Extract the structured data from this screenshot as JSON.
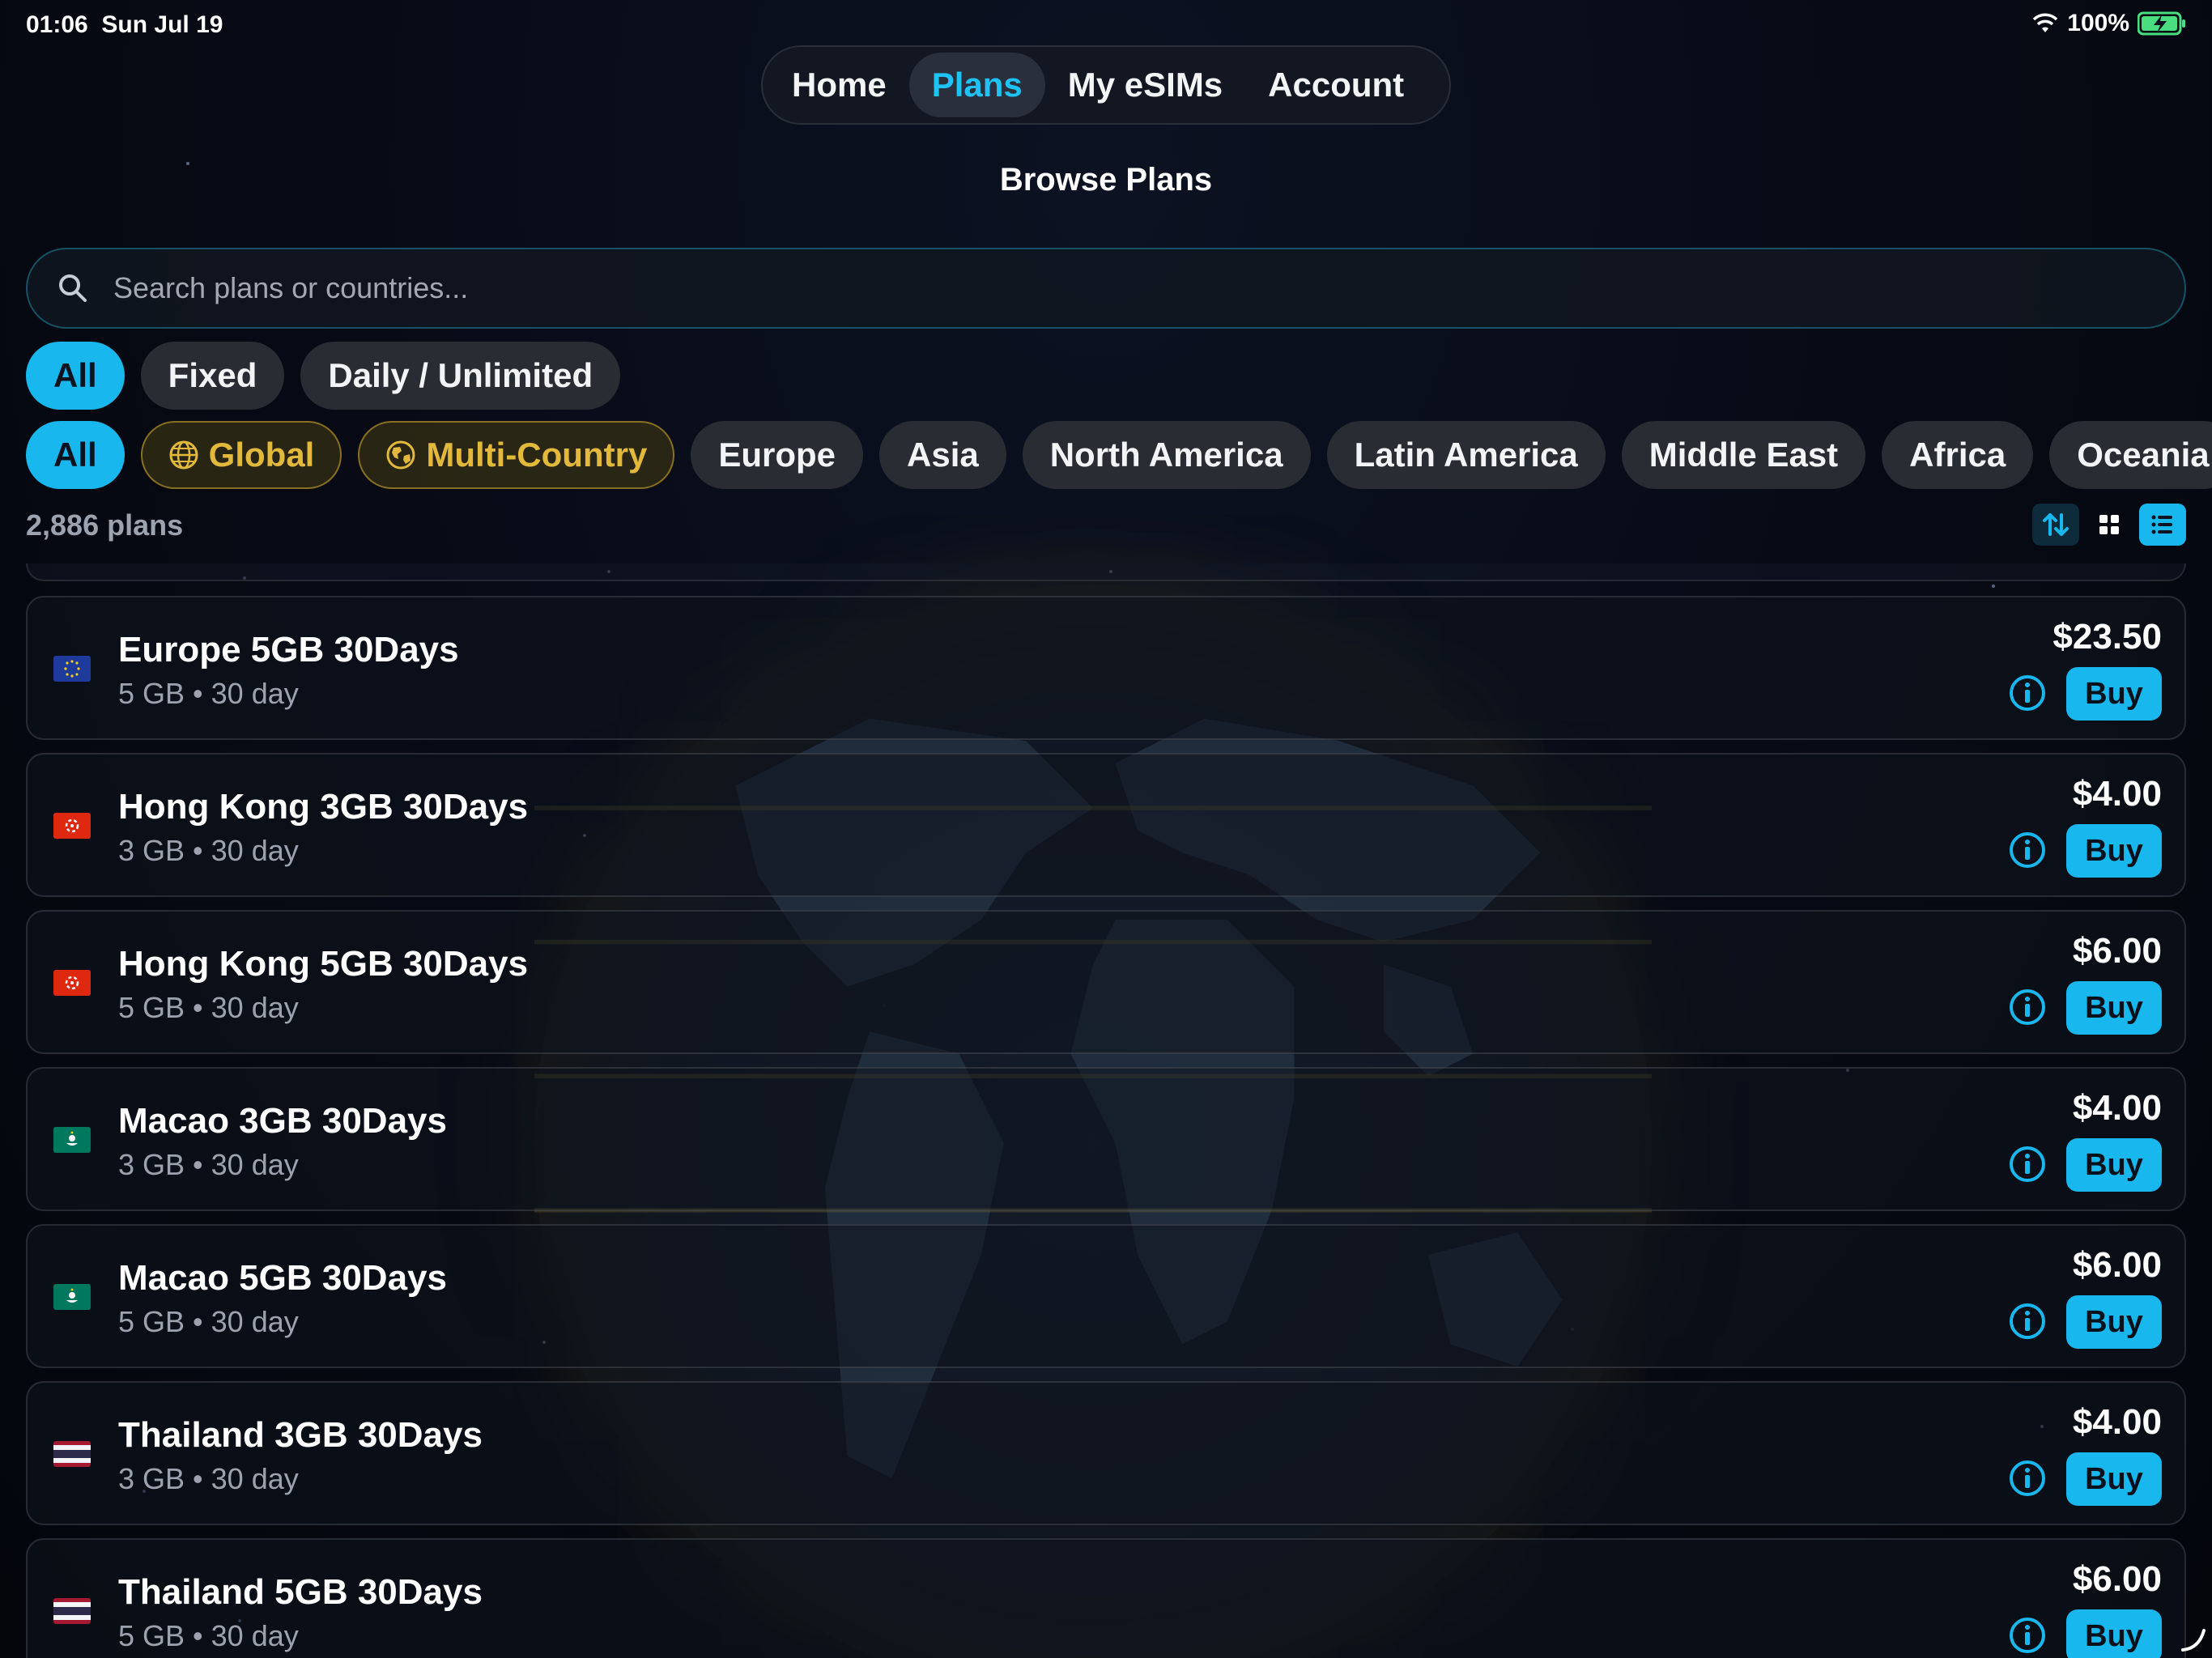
{
  "status_bar": {
    "time": "01:06",
    "date": "Sun Jul 19",
    "battery": "100%"
  },
  "nav": {
    "tabs": [
      {
        "label": "Home",
        "active": false
      },
      {
        "label": "Plans",
        "active": true
      },
      {
        "label": "My eSIMs",
        "active": false
      },
      {
        "label": "Account",
        "active": false
      }
    ]
  },
  "page_title": "Browse Plans",
  "search": {
    "placeholder": "Search plans or countries...",
    "value": ""
  },
  "type_filters": [
    {
      "label": "All",
      "active": true
    },
    {
      "label": "Fixed",
      "active": false
    },
    {
      "label": "Daily / Unlimited",
      "active": false
    }
  ],
  "region_filters": [
    {
      "label": "All",
      "active": true,
      "icon": ""
    },
    {
      "label": "Global",
      "active": false,
      "icon": "globe-grid-icon"
    },
    {
      "label": "Multi-Country",
      "active": false,
      "icon": "earth-icon"
    },
    {
      "label": "Europe",
      "active": false,
      "icon": ""
    },
    {
      "label": "Asia",
      "active": false,
      "icon": ""
    },
    {
      "label": "North America",
      "active": false,
      "icon": ""
    },
    {
      "label": "Latin America",
      "active": false,
      "icon": ""
    },
    {
      "label": "Middle East",
      "active": false,
      "icon": ""
    },
    {
      "label": "Africa",
      "active": false,
      "icon": ""
    },
    {
      "label": "Oceania",
      "active": false,
      "icon": ""
    }
  ],
  "plan_count": "2,886 plans",
  "view_controls": {
    "sort_icon": "sort-arrows-icon",
    "grid_icon": "grid-view-icon",
    "list_icon": "list-view-icon",
    "active_view": "list"
  },
  "plans": [
    {
      "name": "Europe 5GB 30Days",
      "data": "5 GB",
      "duration": "30 day",
      "price": "$23.50",
      "flag": "eu",
      "buy_label": "Buy"
    },
    {
      "name": "Hong Kong 3GB 30Days",
      "data": "3 GB",
      "duration": "30 day",
      "price": "$4.00",
      "flag": "hk",
      "buy_label": "Buy"
    },
    {
      "name": "Hong Kong 5GB 30Days",
      "data": "5 GB",
      "duration": "30 day",
      "price": "$6.00",
      "flag": "hk",
      "buy_label": "Buy"
    },
    {
      "name": "Macao 3GB 30Days",
      "data": "3 GB",
      "duration": "30 day",
      "price": "$4.00",
      "flag": "mo",
      "buy_label": "Buy"
    },
    {
      "name": "Macao 5GB 30Days",
      "data": "5 GB",
      "duration": "30 day",
      "price": "$6.00",
      "flag": "mo",
      "buy_label": "Buy"
    },
    {
      "name": "Thailand 3GB 30Days",
      "data": "3 GB",
      "duration": "30 day",
      "price": "$4.00",
      "flag": "th",
      "buy_label": "Buy"
    },
    {
      "name": "Thailand 5GB 30Days",
      "data": "5 GB",
      "duration": "30 day",
      "price": "$6.00",
      "flag": "th",
      "buy_label": "Buy"
    }
  ],
  "colors": {
    "accent": "#18b8ef",
    "gold": "#e2b93b",
    "background": "#05070f"
  }
}
